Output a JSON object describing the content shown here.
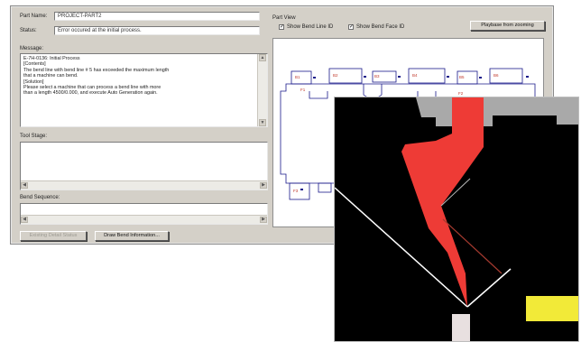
{
  "part_name": {
    "label": "Part Name:",
    "value": "PROJECT-PART2"
  },
  "status": {
    "label": "Status:",
    "value": "Error occured at the initial process."
  },
  "message": {
    "label": "Message:",
    "lines": [
      "E-7H-0136: Initial Process",
      "[Contents]",
      "The bend line with bend line # 5 has exceeded the maximum length",
      "that a machine can bend.",
      "[Solution]",
      "Please select a machine that can process a bend line with more",
      "than a length 4500/0.000, and execute Auto Generation again."
    ]
  },
  "tool_stage": {
    "label": "Tool Stage:"
  },
  "bend_sequence": {
    "label": "Bend Sequence:"
  },
  "buttons": {
    "existing_detail": "Existing Detail Status",
    "draw_bend_info": "Draw Bend Information..."
  },
  "part_view": {
    "label": "Part View",
    "show_bend_line_id": "Show Bend Line ID",
    "show_bend_face_id": "Show Bend Face ID",
    "show_bend_line_checked": true,
    "show_bend_face_checked": true,
    "play_button": "Playbase from zooming",
    "line_color": "#1a1a8a",
    "label_color": "#c0392b"
  },
  "simulation": {
    "background": "#000000",
    "punch_color": "#ee3b36",
    "die_color": "#e8e0e0",
    "tool_holder_color": "#a9a9a9",
    "sheet_color": "#ffffff",
    "marker_color": "#f2ea38"
  }
}
